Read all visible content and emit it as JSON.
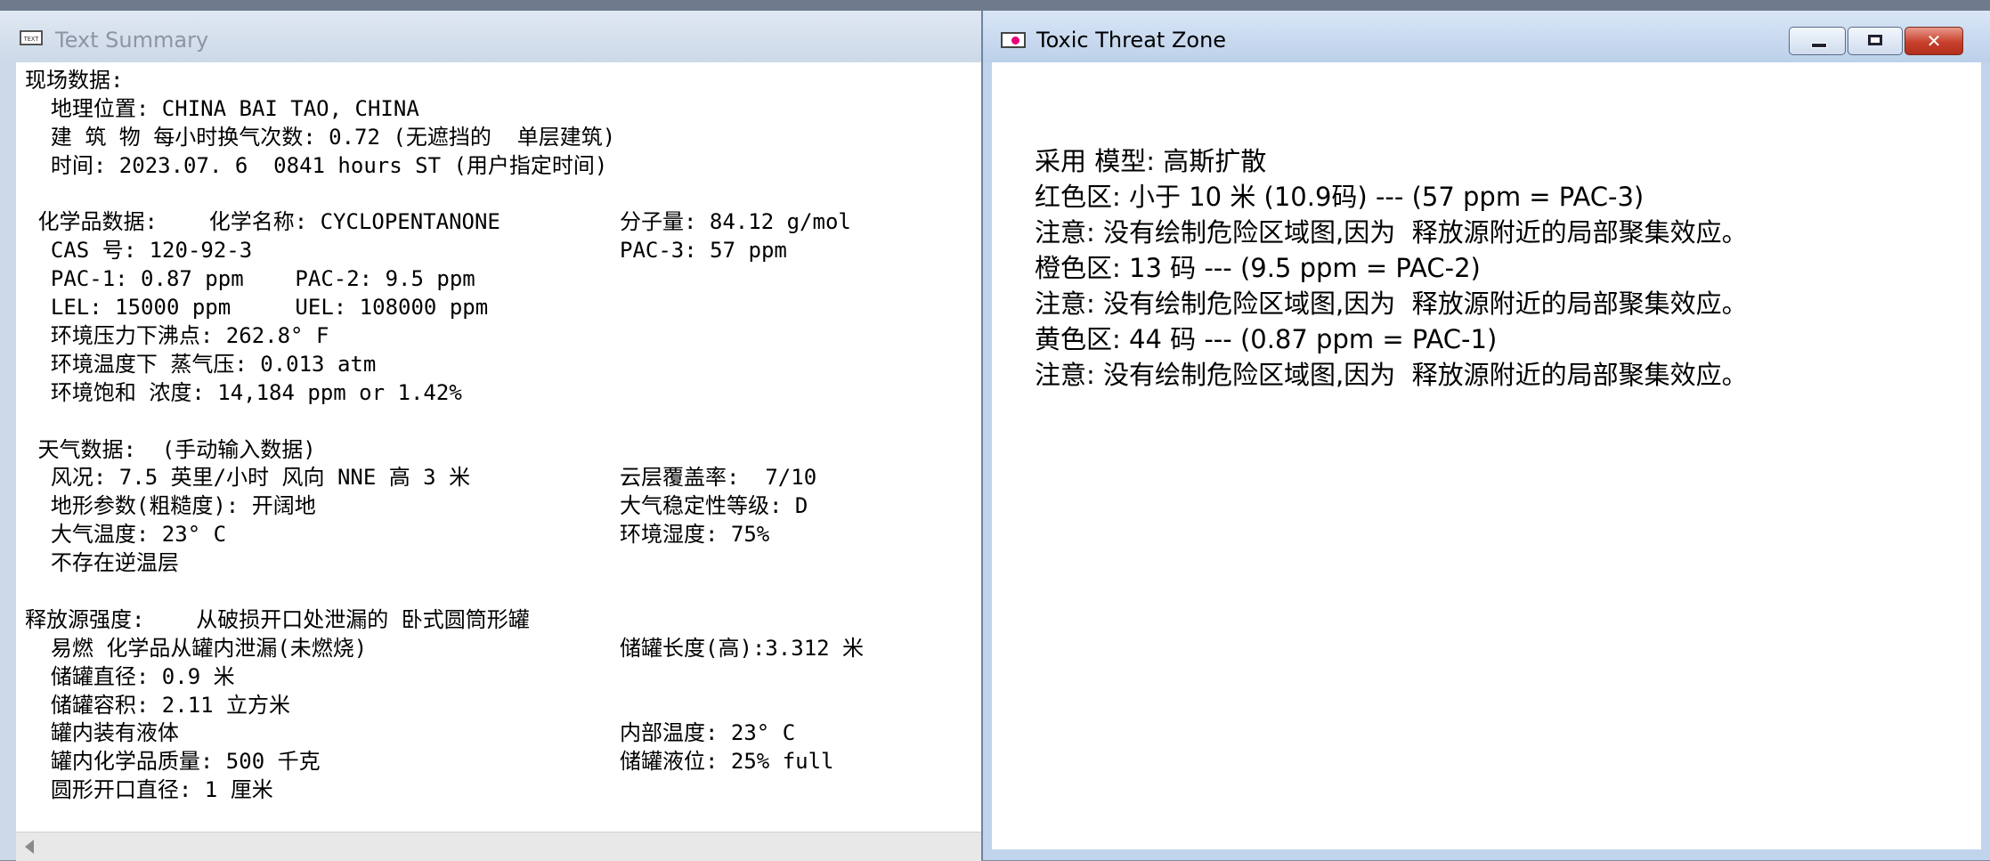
{
  "text_summary_window": {
    "title": "Text Summary",
    "icon": "text-doc-icon",
    "lines": [
      "现场数据:",
      "  地理位置: CHINA BAI TAO, CHINA",
      "  建 筑 物 每小时换气次数: 0.72 (无遮挡的  单层建筑)",
      "  时间: 2023.07. 6  0841 hours ST (用户指定时间)",
      "",
      " 化学品数据:    化学名称: CYCLOPENTANONE",
      "  CAS 号: 120-92-3",
      "  PAC-1: 0.87 ppm    PAC-2: 9.5 ppm",
      "  LEL: 15000 ppm     UEL: 108000 ppm",
      "  环境压力下沸点: 262.8° F",
      "  环境温度下 蒸气压: 0.013 atm",
      "  环境饱和 浓度: 14,184 ppm or 1.42%",
      "",
      " 天气数据:  (手动输入数据)",
      "  风况: 7.5 英里/小时 风向 NNE 高 3 米",
      "  地形参数(粗糙度): 开阔地",
      "  大气温度: 23° C",
      "  不存在逆温层",
      "",
      "释放源强度:    从破损开口处泄漏的 卧式圆筒形罐",
      "  易燃 化学品从罐内泄漏(未燃烧)",
      "  储罐直径: 0.9 米",
      "  储罐容积: 2.11 立方米",
      "  罐内装有液体",
      "  罐内化学品质量: 500 千克",
      "  圆形开口直径: 1 厘米"
    ],
    "right_column": [
      {
        "row": 6,
        "text": "分子量: 84.12 g/mol"
      },
      {
        "row": 7,
        "text": "PAC-3: 57 ppm"
      },
      {
        "row": 15,
        "text": "云层覆盖率:  7/10"
      },
      {
        "row": 16,
        "text": "大气稳定性等级: D"
      },
      {
        "row": 17,
        "text": "环境湿度: 75%"
      },
      {
        "row": 21,
        "text": "储罐长度(高):3.312 米"
      },
      {
        "row": 24,
        "text": "内部温度: 23° C"
      },
      {
        "row": 25,
        "text": "储罐液位: 25% full"
      }
    ]
  },
  "threat_zone_window": {
    "title": "Toxic Threat Zone",
    "icon": "threat-zone-icon",
    "buttons": {
      "minimize": "minimize-icon",
      "maximize": "maximize-icon",
      "close": "close-icon",
      "close_glyph": "✕"
    },
    "lines": [
      "采用 模型: 高斯扩散",
      "红色区: 小于 10 米 (10.9码) --- (57 ppm = PAC-3)",
      "注意: 没有绘制危险区域图,因为  释放源附近的局部聚集效应。",
      "橙色区: 13 码 --- (9.5 ppm = PAC-2)",
      "注意: 没有绘制危险区域图,因为  释放源附近的局部聚集效应。",
      "黄色区: 44 码 --- (0.87 ppm = PAC-1)",
      "注意: 没有绘制危险区域图,因为  释放源附近的局部聚集效应。"
    ]
  }
}
